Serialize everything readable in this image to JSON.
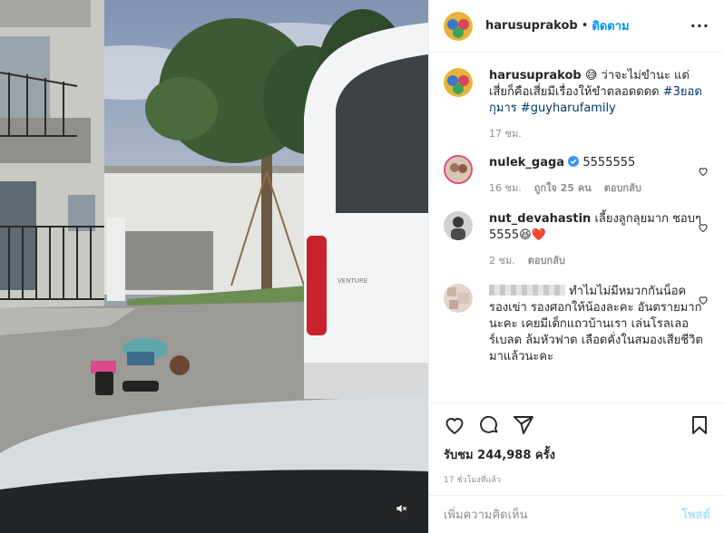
{
  "header": {
    "username": "harusuprakob",
    "dot": "•",
    "follow_label": "ติดตาม",
    "more_label": "···"
  },
  "caption": {
    "username": "harusuprakob",
    "text": "😅 ว่าจะไม่ขำนะ แต่เสี่ยก็คือเสี่ยมีเรื่องให้ขำตลอดดดด",
    "hashtags": [
      "#3ยอดกุมาร",
      "#guyharufamily"
    ],
    "time": "17 ชม."
  },
  "comments": [
    {
      "username": "nulek_gaga",
      "verified": true,
      "text": "5555555",
      "time": "16 ชม.",
      "likes": "ถูกใจ 25 คน",
      "reply": "ตอบกลับ"
    },
    {
      "username": "nut_devahastin",
      "verified": false,
      "text": "เลี้ยงลูกลุยมาก ชอบๆ 5555😆❤️",
      "time": "2 ชม.",
      "reply": "ตอบกลับ"
    },
    {
      "username": "",
      "text": "ทำไมไม่มีหมวกกันน็อค รองเข่า รองศอกให้น้องละคะ อันตรายมากนะคะ เคยมีเด็กแถวบ้านเรา เล่นโรลเลอร์เบลด ล้มหัวฟาด เลือดคั่งในสมองเสียชีวิตมาแล้วนะคะ"
    }
  ],
  "stats": {
    "views": "รับชม 244,988 ครั้ง",
    "ago": "17 ชั่วโมงที่แล้ว"
  },
  "add_comment": {
    "placeholder": "เพิ่มความคิดเห็น",
    "post_label": "โพสต์"
  },
  "icons": {
    "like": "heart-icon",
    "comment": "comment-icon",
    "share": "share-icon",
    "save": "bookmark-icon",
    "mute": "speaker-muted-icon"
  },
  "colors": {
    "accent": "#0095f6",
    "link": "#00376b",
    "muted": "#8e8e8e",
    "verified": "#3897f0",
    "post_disabled": "#b2dffc"
  }
}
